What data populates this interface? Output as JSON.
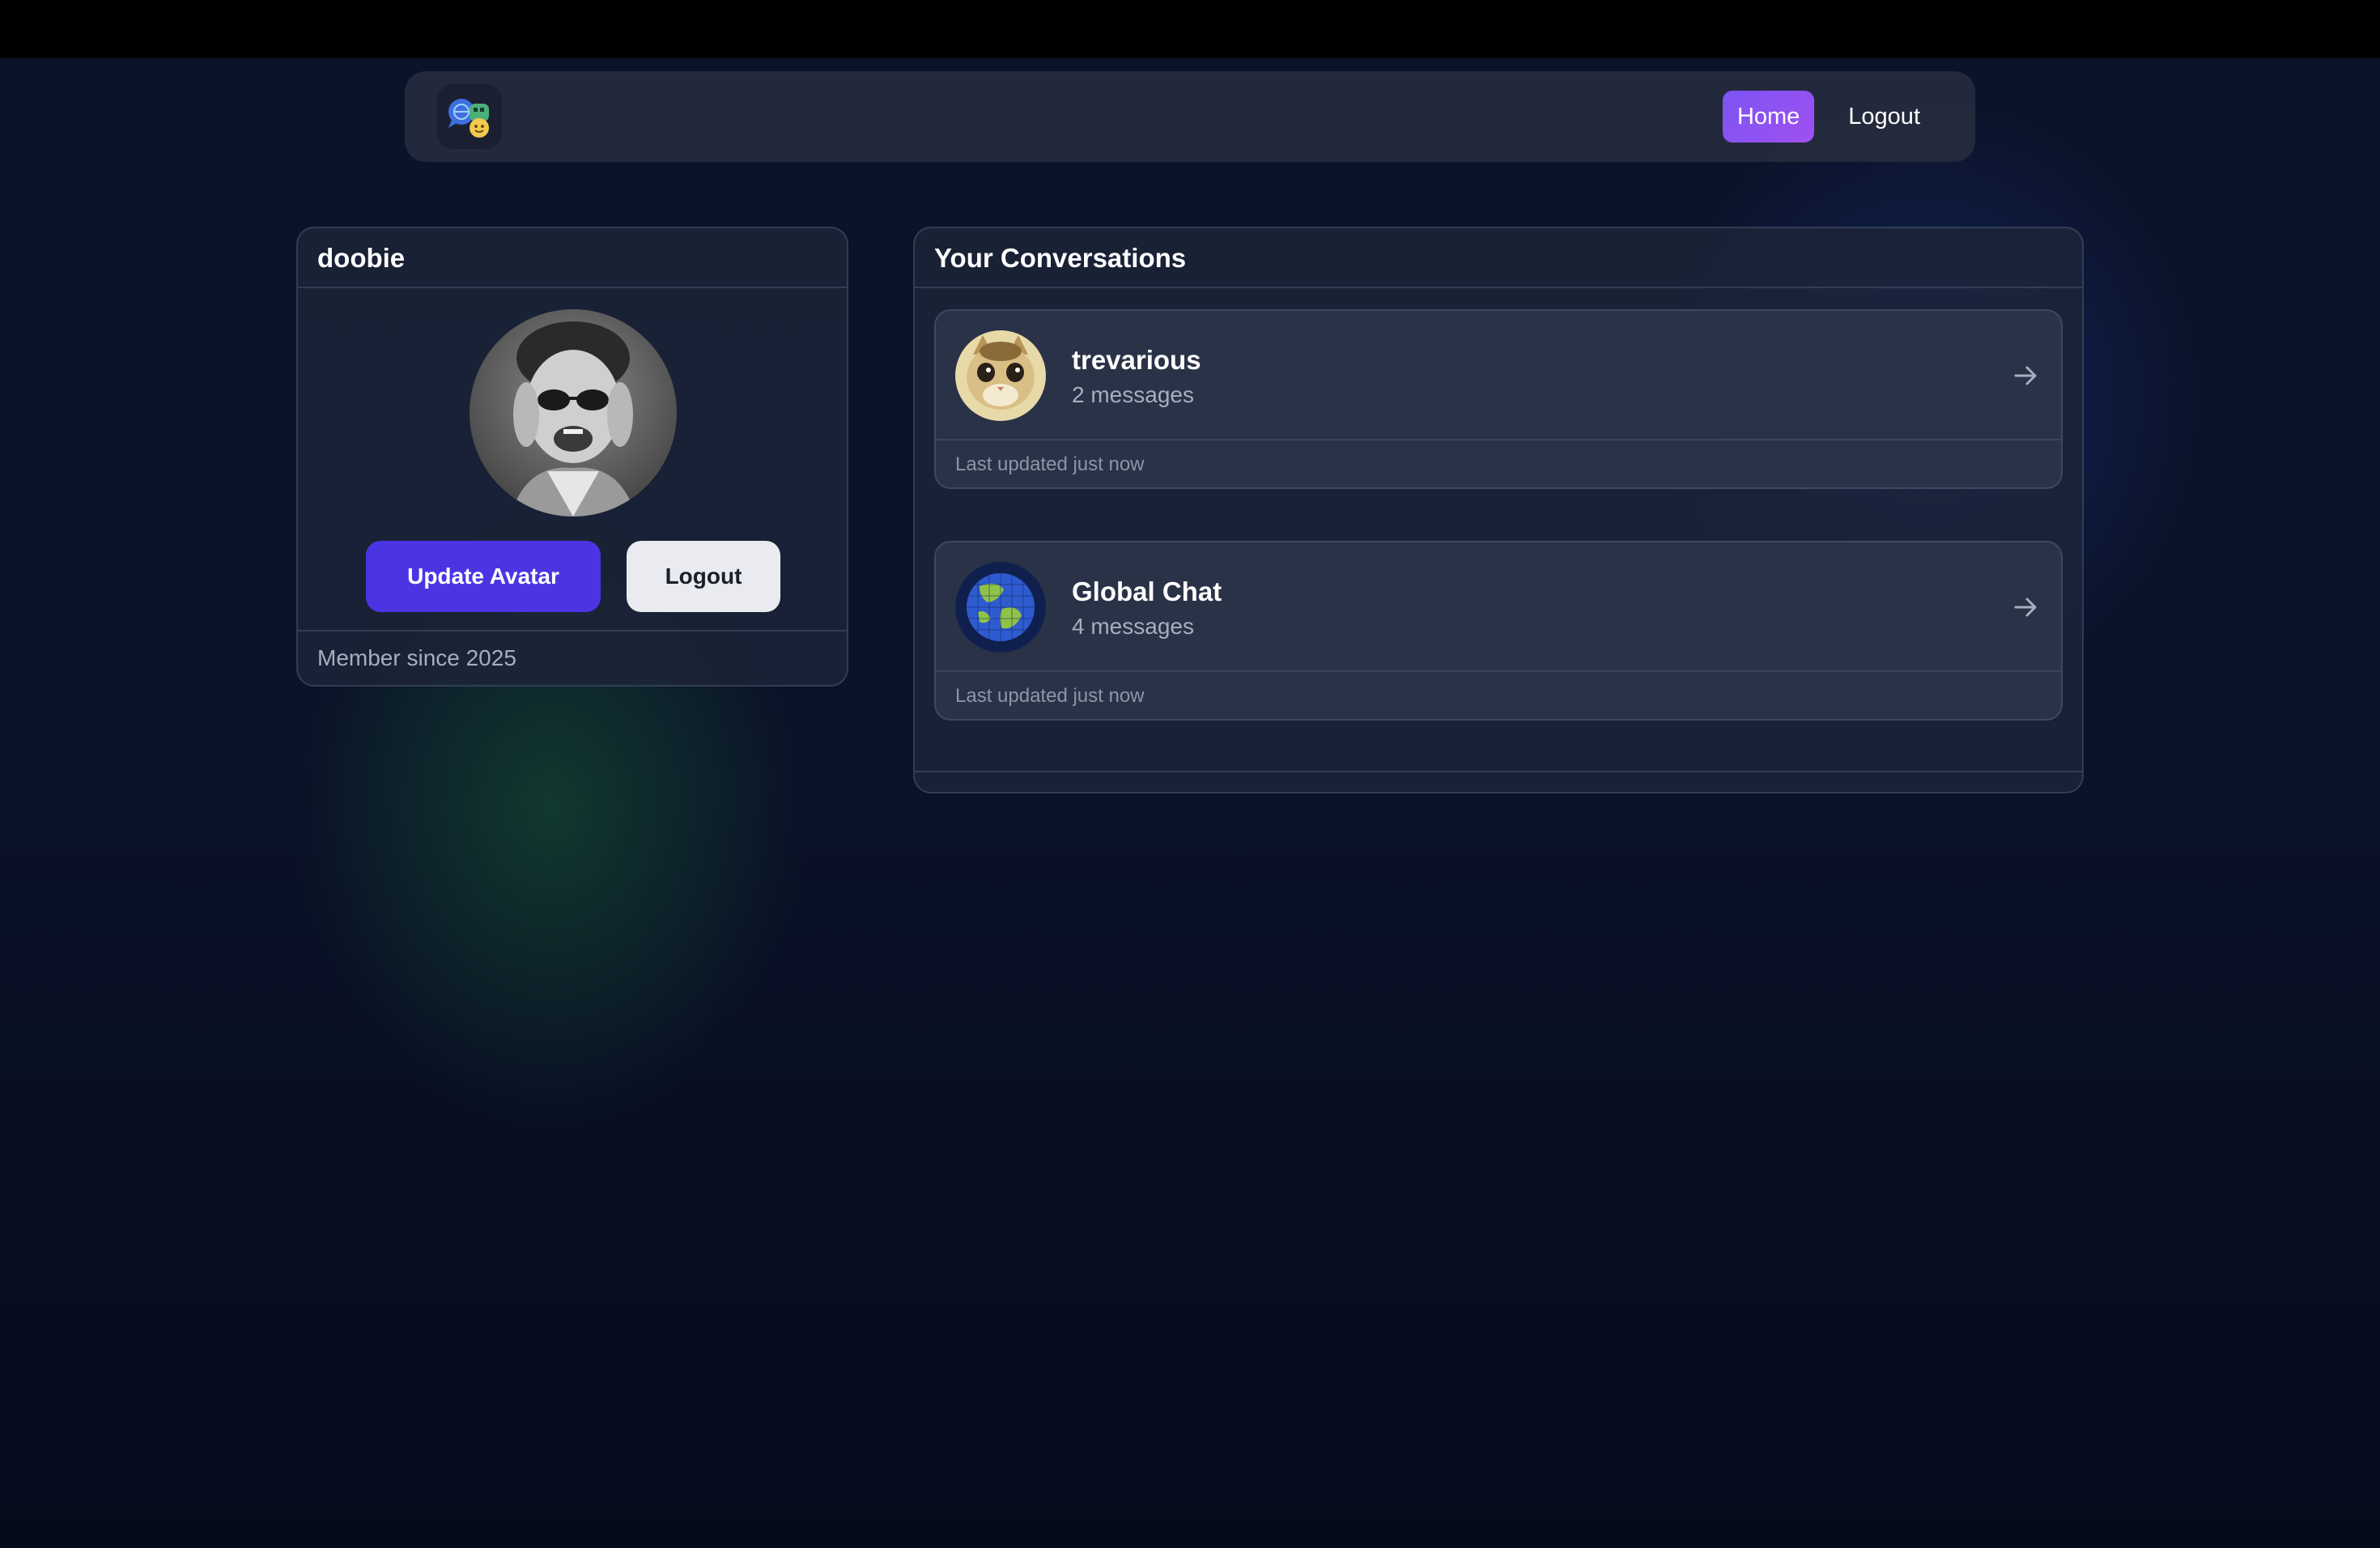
{
  "nav": {
    "home_label": "Home",
    "logout_label": "Logout",
    "logo_icon": "chat-bubbles-logo-icon"
  },
  "profile": {
    "username": "doobie",
    "update_avatar_label": "Update Avatar",
    "logout_label": "Logout",
    "member_since": "Member since 2025"
  },
  "conversations": {
    "title": "Your Conversations",
    "items": [
      {
        "name": "trevarious",
        "count": "2 messages",
        "updated": "Last updated just now",
        "avatar": "cat-photo"
      },
      {
        "name": "Global Chat",
        "count": "4 messages",
        "updated": "Last updated just now",
        "avatar": "globe-icon"
      }
    ]
  },
  "colors": {
    "accent_primary": "#4b35e3",
    "nav_active_gradient_start": "#7b55f3",
    "nav_active_gradient_end": "#a14ff0"
  }
}
